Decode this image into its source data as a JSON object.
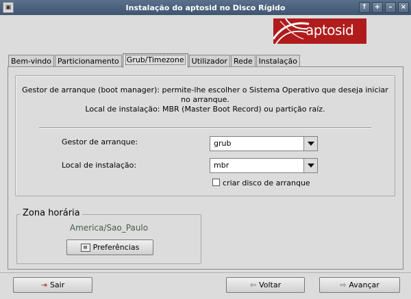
{
  "window": {
    "title": "Instalação do aptosid no Disco Rígido",
    "buttons": [
      "↑",
      "+",
      "–",
      "×"
    ]
  },
  "logo": {
    "text": "aptosid"
  },
  "tabs": [
    {
      "label": "Bem-vindo",
      "active": false
    },
    {
      "label": "Particionamento",
      "active": false
    },
    {
      "label": "Grub/Timezone",
      "active": true
    },
    {
      "label": "Utilizador",
      "active": false
    },
    {
      "label": "Rede",
      "active": false
    },
    {
      "label": "Instalação",
      "active": false
    }
  ],
  "grub": {
    "description_line1": "Gestor de arranque (boot manager): permite-lhe escolher o Sistema Operativo que deseja iniciar",
    "description_line2": "no arranque.",
    "description_line3": "Local de instalação: MBR (Master Boot Record) ou partição raíz.",
    "boot_manager_label": "Gestor de arranque:",
    "boot_manager_value": "grub",
    "install_location_label": "Local de instalação:",
    "install_location_value": "mbr",
    "boot_disk_checkbox_label": "criar disco de arranque",
    "boot_disk_checked": false
  },
  "timezone": {
    "title": "Zona horária",
    "value": "America/Sao_Paulo",
    "preferences_button": "Preferências"
  },
  "footer": {
    "exit_button": "Sair",
    "back_button": "Voltar",
    "next_button": "Avançar"
  }
}
